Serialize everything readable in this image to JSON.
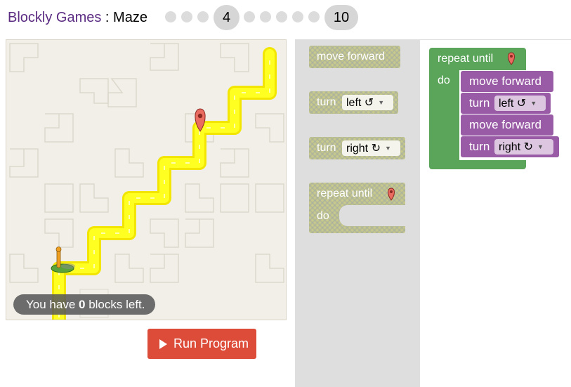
{
  "header": {
    "app_link": "Blockly Games",
    "separator": " : ",
    "game_title": "Maze",
    "current_level": "4",
    "last_level": "10"
  },
  "maze": {
    "status_prefix": "You have ",
    "blocks_left": "0",
    "status_suffix": " blocks left."
  },
  "run_button": {
    "label": "Run Program"
  },
  "toolbox": {
    "move_forward": "move forward",
    "turn_left": {
      "label": "turn",
      "direction": "left ↺"
    },
    "turn_right": {
      "label": "turn",
      "direction": "right ↻"
    },
    "repeat_until": {
      "label": "repeat until",
      "do": "do"
    }
  },
  "program": {
    "repeat_label": "repeat until",
    "do_label": "do",
    "steps": [
      {
        "label": "move forward"
      },
      {
        "label": "turn",
        "direction": "left ↺"
      },
      {
        "label": "move forward"
      },
      {
        "label": "turn",
        "direction": "right ↻"
      }
    ]
  },
  "colors": {
    "brand_link": "#5b2c82",
    "run_button": "#dd4b39",
    "loop_block": "#5ba55b",
    "movement_block": "#995ba5",
    "path": "#ffff00"
  },
  "icons": [
    "marker-icon",
    "pegman-icon",
    "play-icon",
    "dropdown-arrow-icon"
  ]
}
